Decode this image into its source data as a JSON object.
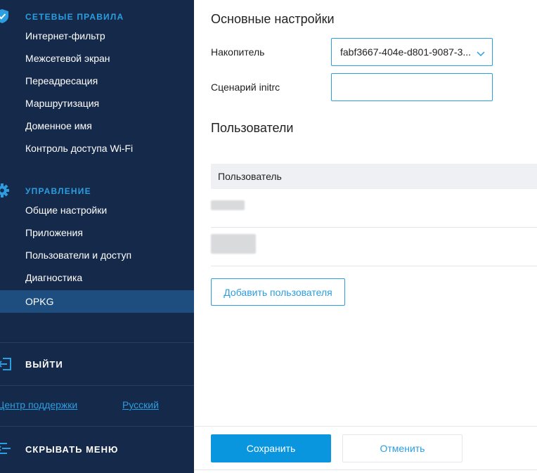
{
  "sidebar": {
    "network_section": {
      "title": "СЕТЕВЫЕ ПРАВИЛА",
      "icon": "shield-check-icon",
      "items": [
        {
          "label": "Интернет-фильтр"
        },
        {
          "label": "Межсетевой экран"
        },
        {
          "label": "Переадресация"
        },
        {
          "label": "Маршрутизация"
        },
        {
          "label": "Доменное имя"
        },
        {
          "label": "Контроль доступа Wi-Fi"
        }
      ]
    },
    "management_section": {
      "title": "УПРАВЛЕНИЕ",
      "icon": "gear-icon",
      "items": [
        {
          "label": "Общие настройки"
        },
        {
          "label": "Приложения"
        },
        {
          "label": "Пользователи и доступ"
        },
        {
          "label": "Диагностика"
        },
        {
          "label": "OPKG",
          "active": true
        }
      ]
    },
    "logout_label": "ВЫЙТИ",
    "support_link": "Центр поддержки",
    "language_link": "Русский",
    "hide_menu_label": "СКРЫВАТЬ МЕНЮ"
  },
  "main": {
    "basic_settings_title": "Основные настройки",
    "storage": {
      "label": "Накопитель",
      "value": "fabf3667-404e-d801-9087-3..."
    },
    "initrc": {
      "label": "Сценарий initrc",
      "value": ""
    },
    "users_title": "Пользователи",
    "users_table": {
      "column_header": "Пользователь",
      "rows": [
        {
          "name": ""
        },
        {
          "name": ""
        }
      ]
    },
    "add_user_button": "Добавить пользователя",
    "save_button": "Сохранить",
    "cancel_button": "Отменить"
  },
  "colors": {
    "sidebar_bg": "#15294a",
    "accent": "#2a9ee0",
    "active_item_bg": "#1d4e7f",
    "primary_button": "#0a96de"
  }
}
